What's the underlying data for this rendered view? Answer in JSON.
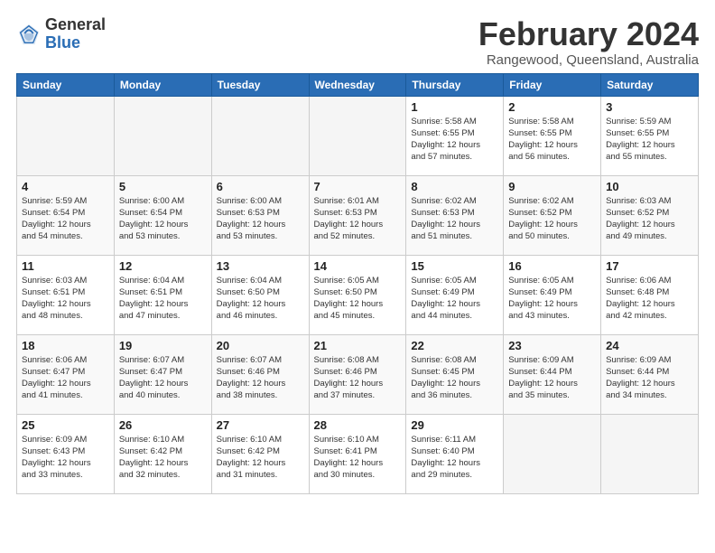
{
  "logo": {
    "general": "General",
    "blue": "Blue"
  },
  "title": "February 2024",
  "subtitle": "Rangewood, Queensland, Australia",
  "weekdays": [
    "Sunday",
    "Monday",
    "Tuesday",
    "Wednesday",
    "Thursday",
    "Friday",
    "Saturday"
  ],
  "weeks": [
    [
      {
        "day": "",
        "info": ""
      },
      {
        "day": "",
        "info": ""
      },
      {
        "day": "",
        "info": ""
      },
      {
        "day": "",
        "info": ""
      },
      {
        "day": "1",
        "info": "Sunrise: 5:58 AM\nSunset: 6:55 PM\nDaylight: 12 hours\nand 57 minutes."
      },
      {
        "day": "2",
        "info": "Sunrise: 5:58 AM\nSunset: 6:55 PM\nDaylight: 12 hours\nand 56 minutes."
      },
      {
        "day": "3",
        "info": "Sunrise: 5:59 AM\nSunset: 6:55 PM\nDaylight: 12 hours\nand 55 minutes."
      }
    ],
    [
      {
        "day": "4",
        "info": "Sunrise: 5:59 AM\nSunset: 6:54 PM\nDaylight: 12 hours\nand 54 minutes."
      },
      {
        "day": "5",
        "info": "Sunrise: 6:00 AM\nSunset: 6:54 PM\nDaylight: 12 hours\nand 53 minutes."
      },
      {
        "day": "6",
        "info": "Sunrise: 6:00 AM\nSunset: 6:53 PM\nDaylight: 12 hours\nand 53 minutes."
      },
      {
        "day": "7",
        "info": "Sunrise: 6:01 AM\nSunset: 6:53 PM\nDaylight: 12 hours\nand 52 minutes."
      },
      {
        "day": "8",
        "info": "Sunrise: 6:02 AM\nSunset: 6:53 PM\nDaylight: 12 hours\nand 51 minutes."
      },
      {
        "day": "9",
        "info": "Sunrise: 6:02 AM\nSunset: 6:52 PM\nDaylight: 12 hours\nand 50 minutes."
      },
      {
        "day": "10",
        "info": "Sunrise: 6:03 AM\nSunset: 6:52 PM\nDaylight: 12 hours\nand 49 minutes."
      }
    ],
    [
      {
        "day": "11",
        "info": "Sunrise: 6:03 AM\nSunset: 6:51 PM\nDaylight: 12 hours\nand 48 minutes."
      },
      {
        "day": "12",
        "info": "Sunrise: 6:04 AM\nSunset: 6:51 PM\nDaylight: 12 hours\nand 47 minutes."
      },
      {
        "day": "13",
        "info": "Sunrise: 6:04 AM\nSunset: 6:50 PM\nDaylight: 12 hours\nand 46 minutes."
      },
      {
        "day": "14",
        "info": "Sunrise: 6:05 AM\nSunset: 6:50 PM\nDaylight: 12 hours\nand 45 minutes."
      },
      {
        "day": "15",
        "info": "Sunrise: 6:05 AM\nSunset: 6:49 PM\nDaylight: 12 hours\nand 44 minutes."
      },
      {
        "day": "16",
        "info": "Sunrise: 6:05 AM\nSunset: 6:49 PM\nDaylight: 12 hours\nand 43 minutes."
      },
      {
        "day": "17",
        "info": "Sunrise: 6:06 AM\nSunset: 6:48 PM\nDaylight: 12 hours\nand 42 minutes."
      }
    ],
    [
      {
        "day": "18",
        "info": "Sunrise: 6:06 AM\nSunset: 6:47 PM\nDaylight: 12 hours\nand 41 minutes."
      },
      {
        "day": "19",
        "info": "Sunrise: 6:07 AM\nSunset: 6:47 PM\nDaylight: 12 hours\nand 40 minutes."
      },
      {
        "day": "20",
        "info": "Sunrise: 6:07 AM\nSunset: 6:46 PM\nDaylight: 12 hours\nand 38 minutes."
      },
      {
        "day": "21",
        "info": "Sunrise: 6:08 AM\nSunset: 6:46 PM\nDaylight: 12 hours\nand 37 minutes."
      },
      {
        "day": "22",
        "info": "Sunrise: 6:08 AM\nSunset: 6:45 PM\nDaylight: 12 hours\nand 36 minutes."
      },
      {
        "day": "23",
        "info": "Sunrise: 6:09 AM\nSunset: 6:44 PM\nDaylight: 12 hours\nand 35 minutes."
      },
      {
        "day": "24",
        "info": "Sunrise: 6:09 AM\nSunset: 6:44 PM\nDaylight: 12 hours\nand 34 minutes."
      }
    ],
    [
      {
        "day": "25",
        "info": "Sunrise: 6:09 AM\nSunset: 6:43 PM\nDaylight: 12 hours\nand 33 minutes."
      },
      {
        "day": "26",
        "info": "Sunrise: 6:10 AM\nSunset: 6:42 PM\nDaylight: 12 hours\nand 32 minutes."
      },
      {
        "day": "27",
        "info": "Sunrise: 6:10 AM\nSunset: 6:42 PM\nDaylight: 12 hours\nand 31 minutes."
      },
      {
        "day": "28",
        "info": "Sunrise: 6:10 AM\nSunset: 6:41 PM\nDaylight: 12 hours\nand 30 minutes."
      },
      {
        "day": "29",
        "info": "Sunrise: 6:11 AM\nSunset: 6:40 PM\nDaylight: 12 hours\nand 29 minutes."
      },
      {
        "day": "",
        "info": ""
      },
      {
        "day": "",
        "info": ""
      }
    ]
  ]
}
